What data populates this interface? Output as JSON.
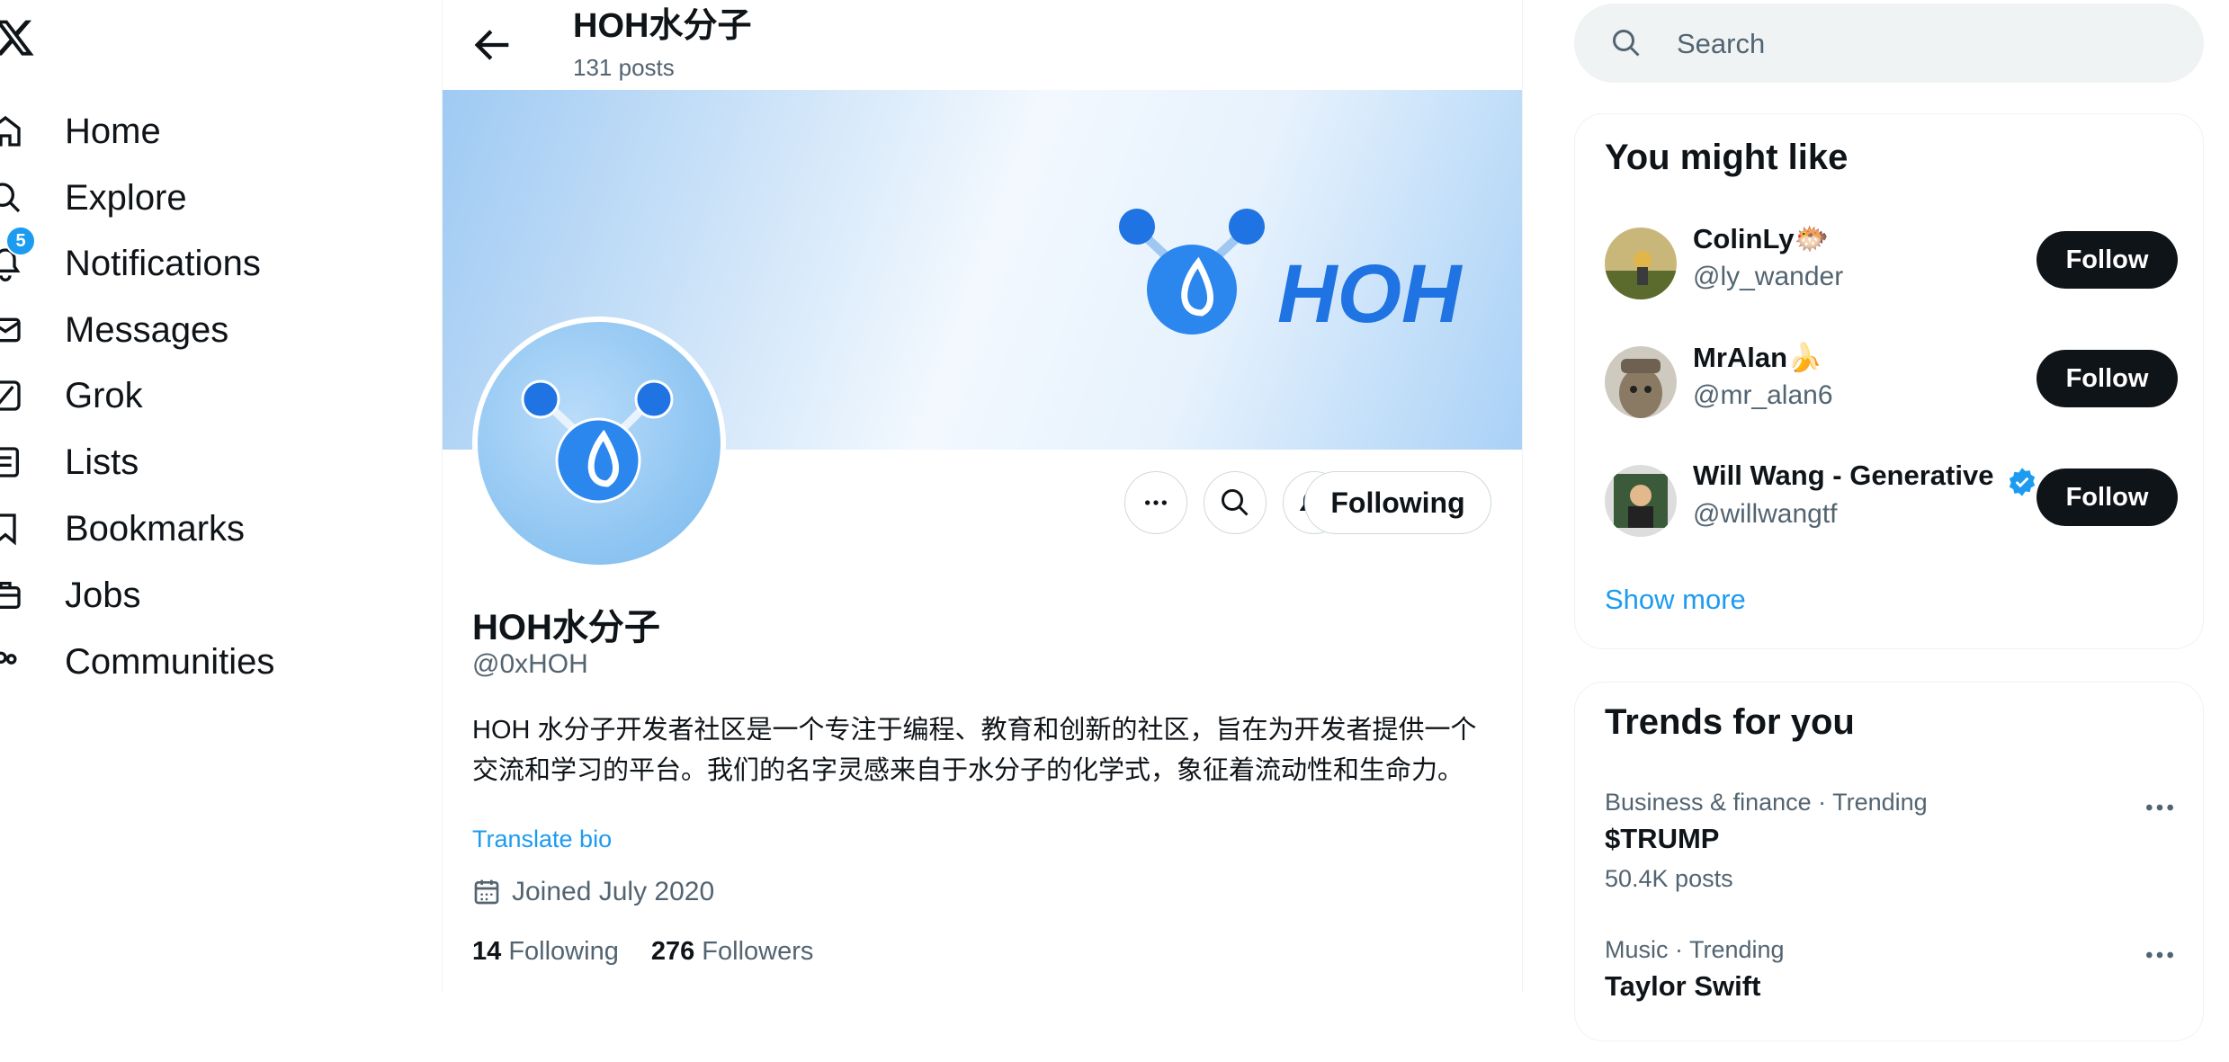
{
  "nav": {
    "items": [
      {
        "label": "Home",
        "icon": "home-icon"
      },
      {
        "label": "Explore",
        "icon": "search-icon"
      },
      {
        "label": "Notifications",
        "icon": "bell-icon",
        "badge": "5"
      },
      {
        "label": "Messages",
        "icon": "envelope-icon"
      },
      {
        "label": "Grok",
        "icon": "grok-icon"
      },
      {
        "label": "Lists",
        "icon": "list-icon"
      },
      {
        "label": "Bookmarks",
        "icon": "bookmark-icon"
      },
      {
        "label": "Jobs",
        "icon": "briefcase-icon"
      },
      {
        "label": "Communities",
        "icon": "people-icon"
      }
    ]
  },
  "header": {
    "title": "HOH水分子",
    "posts": "131 posts"
  },
  "banner": {
    "logo_text": "HOH"
  },
  "profile": {
    "display_name": "HOH水分子",
    "handle": "@0xHOH",
    "bio": "HOH 水分子开发者社区是一个专注于编程、教育和创新的社区，旨在为开发者提供一个交流和学习的平台。我们的名字灵感来自于水分子的化学式，象征着流动性和生命力。",
    "translate_label": "Translate bio",
    "joined": "Joined July 2020",
    "following_count": "14",
    "following_label": "Following",
    "followers_count": "276",
    "followers_label": "Followers",
    "following_button": "Following"
  },
  "search": {
    "placeholder": "Search"
  },
  "who_to_follow": {
    "title": "You might like",
    "users": [
      {
        "name": "ColinLy🐡",
        "handle": "@ly_wander",
        "button": "Follow"
      },
      {
        "name": "MrAlan🍌",
        "handle": "@mr_alan6",
        "button": "Follow"
      },
      {
        "name": "Will Wang - Generative",
        "handle": "@willwangtf",
        "button": "Follow",
        "verified": true
      }
    ],
    "show_more": "Show more"
  },
  "trends": {
    "title": "Trends for you",
    "items": [
      {
        "meta": "Business & finance · Trending",
        "name": "$TRUMP",
        "count": "50.4K posts"
      },
      {
        "meta": "Music · Trending",
        "name": "Taylor Swift",
        "count": ""
      }
    ]
  },
  "colors": {
    "accent": "#1d9bf0",
    "text": "#0f1419",
    "muted": "#536471",
    "button_dark": "#0f1419"
  }
}
